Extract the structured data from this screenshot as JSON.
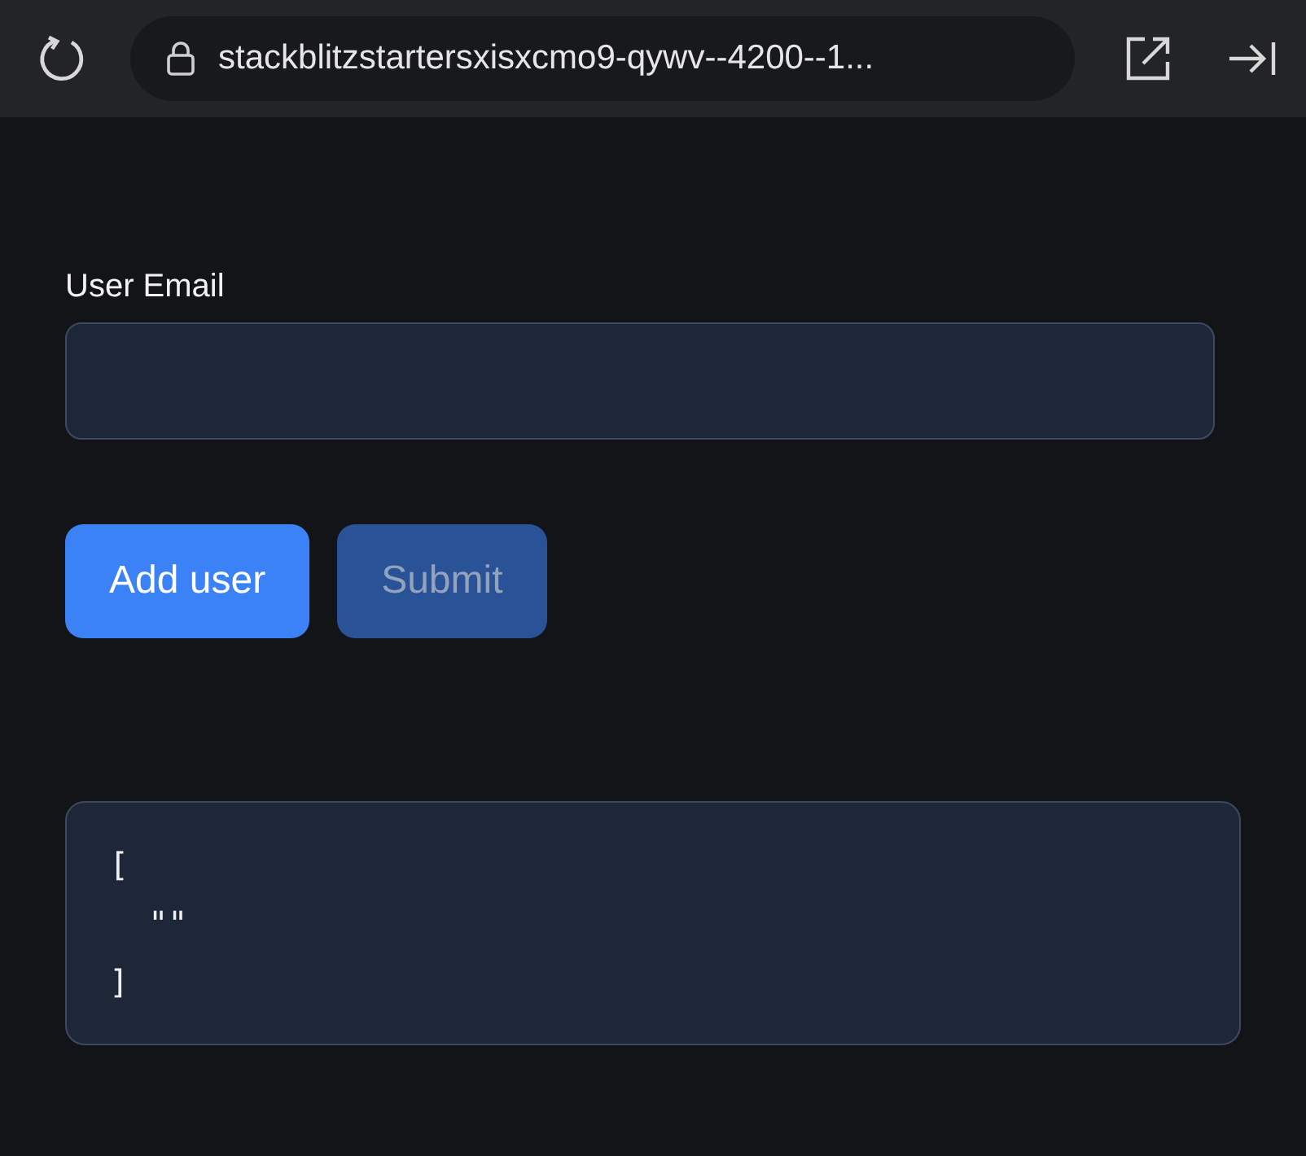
{
  "browser_bar": {
    "url": "stackblitzstartersxisxcmo9-qywv--4200--1..."
  },
  "form": {
    "email_label": "User Email"
  },
  "buttons": [
    {
      "label": "Add user",
      "disabled": false
    },
    {
      "label": "Submit",
      "disabled": true
    }
  ],
  "output": "[\n  \"\"\n]"
}
